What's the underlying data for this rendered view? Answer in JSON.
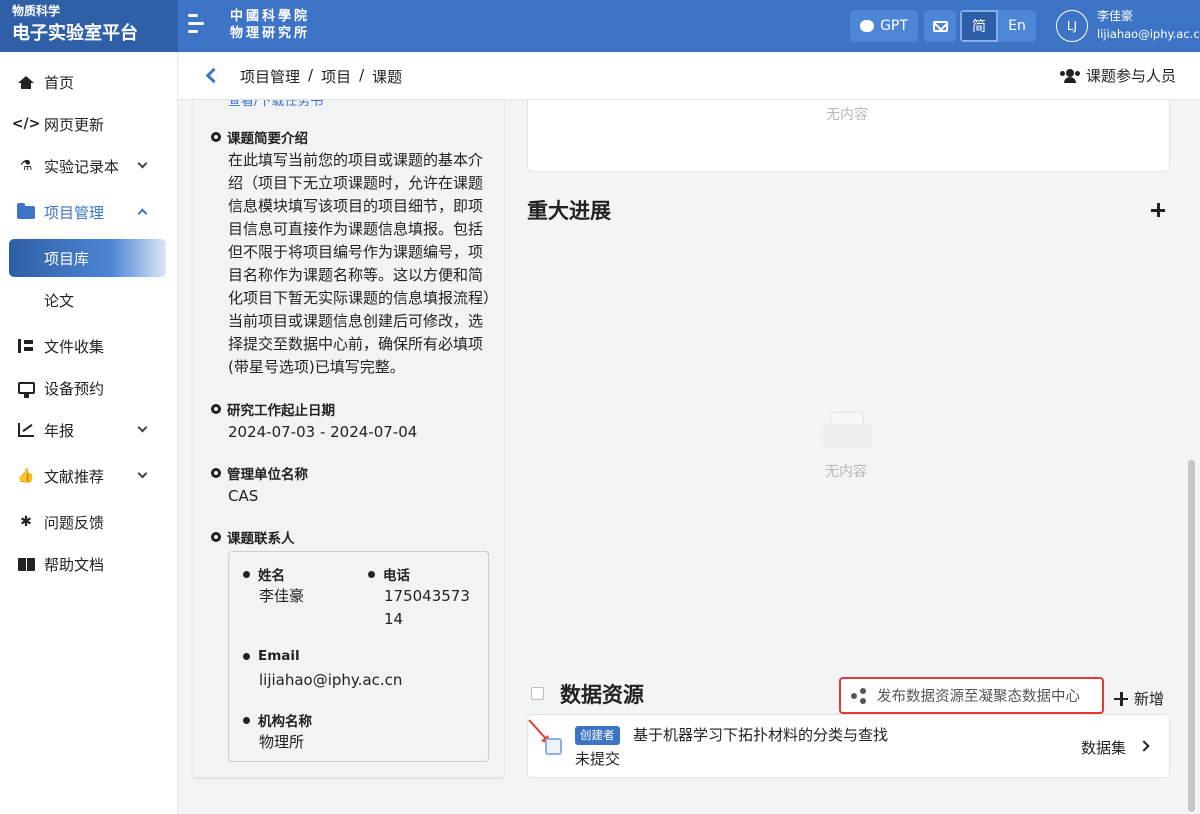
{
  "header": {
    "brand_top": "物质科学",
    "brand_main": "电子实验室平台",
    "institute_line1": "中國科學院",
    "institute_line2": "物理研究所",
    "gpt_label": "GPT",
    "lang_zh": "简",
    "lang_en": "En",
    "avatar_initials": "LJ",
    "user_name": "李佳豪",
    "user_email": "lijiahao@iphy.ac.cn",
    "brand_color": "#3d74c6"
  },
  "sidebar": {
    "items": [
      {
        "label": "首页",
        "icon": "home-icon"
      },
      {
        "label": "网页更新",
        "icon": "code-icon"
      },
      {
        "label": "实验记录本",
        "icon": "flask-icon"
      },
      {
        "label": "项目管理",
        "icon": "folder-icon"
      },
      {
        "label": "项目库"
      },
      {
        "label": "论文"
      },
      {
        "label": "文件收集",
        "icon": "tree-icon"
      },
      {
        "label": "设备预约",
        "icon": "monitor-icon"
      },
      {
        "label": "年报",
        "icon": "chart-icon"
      },
      {
        "label": "文献推荐",
        "icon": "thumbs-up-icon"
      },
      {
        "label": "问题反馈",
        "icon": "bug-icon"
      },
      {
        "label": "帮助文档",
        "icon": "book-icon"
      }
    ]
  },
  "breadcrumb": {
    "items": [
      "项目管理",
      "项目",
      "课题"
    ],
    "sep": "/",
    "participants_label": "课题参与人员"
  },
  "info": {
    "cut_link": "查看/下载任务书",
    "intro_title": "课题简要介绍",
    "intro_text": "在此填写当前您的项目或课题的基本介绍（项目下无立项课题时，允许在课题信息模块填写该项目的项目细节，即项目信息可直接作为课题信息填报。包括但不限于将项目编号作为课题编号，项目名称作为课题名称等。这以方便和简化项目下暂无实际课题的信息填报流程）当前项目或课题信息创建后可修改，选择提交至数据中心前，确保所有必填项(带星号选项)已填写完整。",
    "period_title": "研究工作起止日期",
    "period_value": "2024-07-03 - 2024-07-04",
    "unit_title": "管理单位名称",
    "unit_value": "CAS",
    "contact_title": "课题联系人",
    "contact": {
      "name_label": "姓名",
      "name_value": "李佳豪",
      "phone_label": "电话",
      "phone_line1": "175043573",
      "phone_line2": "14",
      "email_label": "Email",
      "email_value": "lijiahao@iphy.ac.cn",
      "org_label": "机构名称",
      "org_value": "物理所"
    }
  },
  "main": {
    "empty_text": "无内容",
    "progress_title": "重大进展",
    "data_title": "数据资源",
    "publish_label": "发布数据资源至凝聚态数据中心",
    "add_label": "新增",
    "dataset": {
      "badge": "创建者",
      "title": "基于机器学习下拓扑材料的分类与查找",
      "status": "未提交",
      "type": "数据集"
    },
    "highlight_color": "#e53935"
  }
}
